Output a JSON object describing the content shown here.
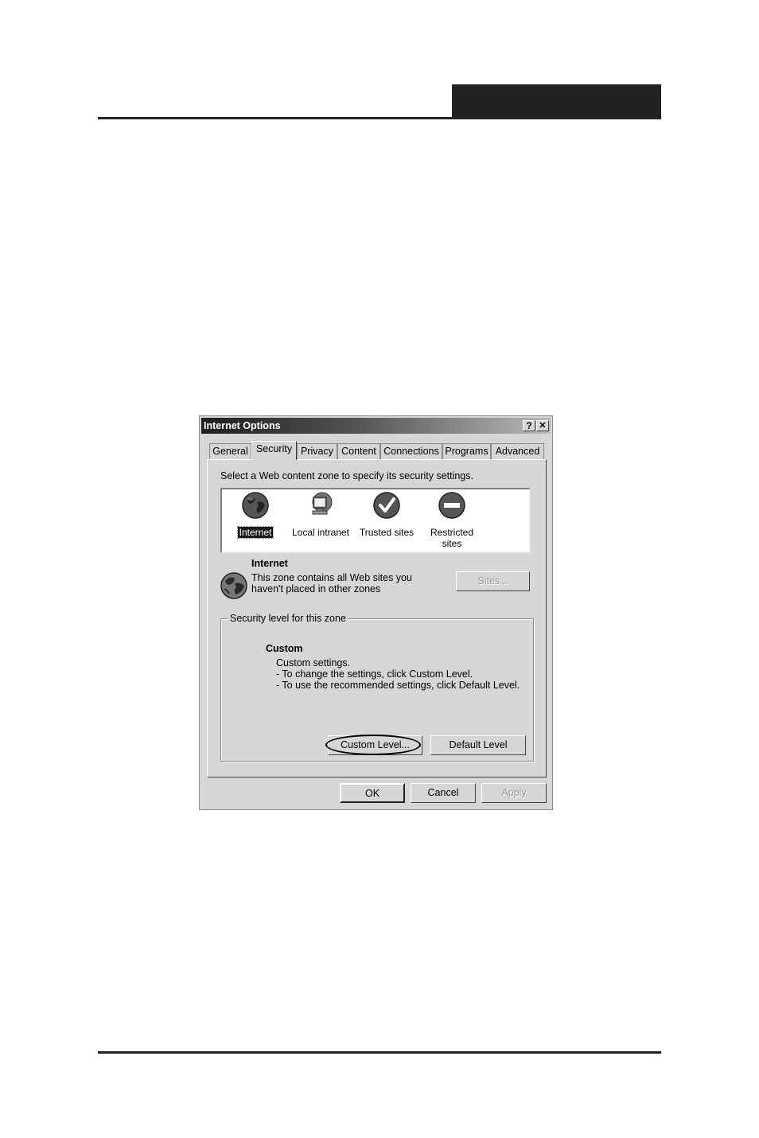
{
  "dialog": {
    "title": "Internet Options",
    "help_glyph": "?",
    "close_glyph": "✕"
  },
  "tabs": [
    {
      "label": "General"
    },
    {
      "label": "Security",
      "active": true
    },
    {
      "label": "Privacy"
    },
    {
      "label": "Content"
    },
    {
      "label": "Connections"
    },
    {
      "label": "Programs"
    },
    {
      "label": "Advanced"
    }
  ],
  "security": {
    "instruction": "Select a Web content zone to specify its security settings.",
    "zones": [
      {
        "label": "Internet",
        "icon": "globe-icon",
        "selected": true
      },
      {
        "label": "Local intranet",
        "icon": "intranet-monitor-icon"
      },
      {
        "label": "Trusted sites",
        "icon": "checkmark-icon"
      },
      {
        "label": "Restricted sites",
        "icon": "no-entry-icon"
      }
    ],
    "zone_info": {
      "title": "Internet",
      "line1": "This zone contains all Web sites you",
      "line2": "haven't placed in other zones",
      "sites_button": "Sites..."
    },
    "level_group": {
      "legend": "Security level for this zone",
      "level_name": "Custom",
      "desc1": "Custom settings.",
      "desc2": "- To change the settings, click Custom Level.",
      "desc3": "- To use the recommended settings, click Default Level.",
      "custom_level_button": "Custom Level...",
      "default_level_button": "Default Level"
    }
  },
  "footer_buttons": {
    "ok": "OK",
    "cancel": "Cancel",
    "apply": "Apply"
  }
}
